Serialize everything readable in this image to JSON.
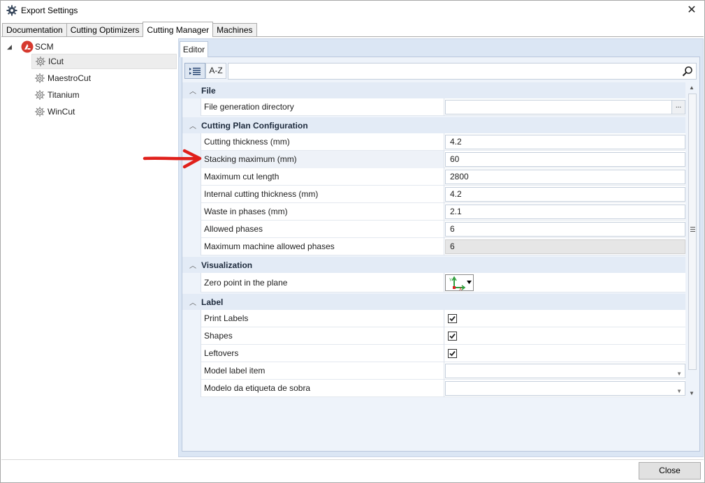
{
  "window": {
    "title": "Export Settings",
    "close_glyph": "✕"
  },
  "tabs": [
    {
      "label": "Documentation",
      "active": false
    },
    {
      "label": "Cutting Optimizers",
      "active": false
    },
    {
      "label": "Cutting Manager",
      "active": true
    },
    {
      "label": "Machines",
      "active": false
    }
  ],
  "tree": {
    "root": {
      "label": "SCM",
      "icon": "scm-logo-icon",
      "expanded_glyph": "◢"
    },
    "items": [
      {
        "label": "ICut",
        "icon": "gear-icon",
        "selected": true
      },
      {
        "label": "MaestroCut",
        "icon": "gear-icon",
        "selected": false
      },
      {
        "label": "Titanium",
        "icon": "gear-icon",
        "selected": false
      },
      {
        "label": "WinCut",
        "icon": "gear-icon",
        "selected": false
      }
    ]
  },
  "editor": {
    "tab_label": "Editor",
    "toolbar": {
      "categorized_icon": "categorized-icon",
      "az_label": "A-Z"
    },
    "search": {
      "value": "",
      "icon": "search-icon"
    },
    "categories": [
      {
        "label": "File",
        "rows": [
          {
            "name": "File generation directory",
            "value": "",
            "browse_label": "..."
          }
        ]
      },
      {
        "label": "Cutting Plan Configuration",
        "rows": [
          {
            "name": "Cutting thickness (mm)",
            "value": "4.2"
          },
          {
            "name": "Stacking maximum (mm)",
            "value": "60"
          },
          {
            "name": "Maximum cut length",
            "value": "2800"
          },
          {
            "name": "Internal cutting thickness (mm)",
            "value": "4.2"
          },
          {
            "name": "Waste in phases (mm)",
            "value": "2.1"
          },
          {
            "name": "Allowed phases",
            "value": "6"
          },
          {
            "name": "Maximum machine allowed phases",
            "value": "6"
          }
        ]
      },
      {
        "label": "Visualization",
        "rows": [
          {
            "name": "Zero point in the plane",
            "value_icon": "axes-origin-icon"
          }
        ]
      },
      {
        "label": "Label",
        "rows": [
          {
            "name": "Print Labels",
            "checked": true
          },
          {
            "name": "Shapes",
            "checked": true
          },
          {
            "name": "Leftovers",
            "checked": true
          },
          {
            "name": "Model label item",
            "value": ""
          },
          {
            "name": "Modelo da etiqueta de sobra",
            "value": ""
          }
        ]
      }
    ]
  },
  "footer": {
    "close_label": "Close"
  },
  "colors": {
    "annotation_arrow": "#e0201b",
    "category_bg": "#e3ebf6",
    "editor_bg": "#dbe6f4",
    "scm_logo": "#d63a2f"
  }
}
